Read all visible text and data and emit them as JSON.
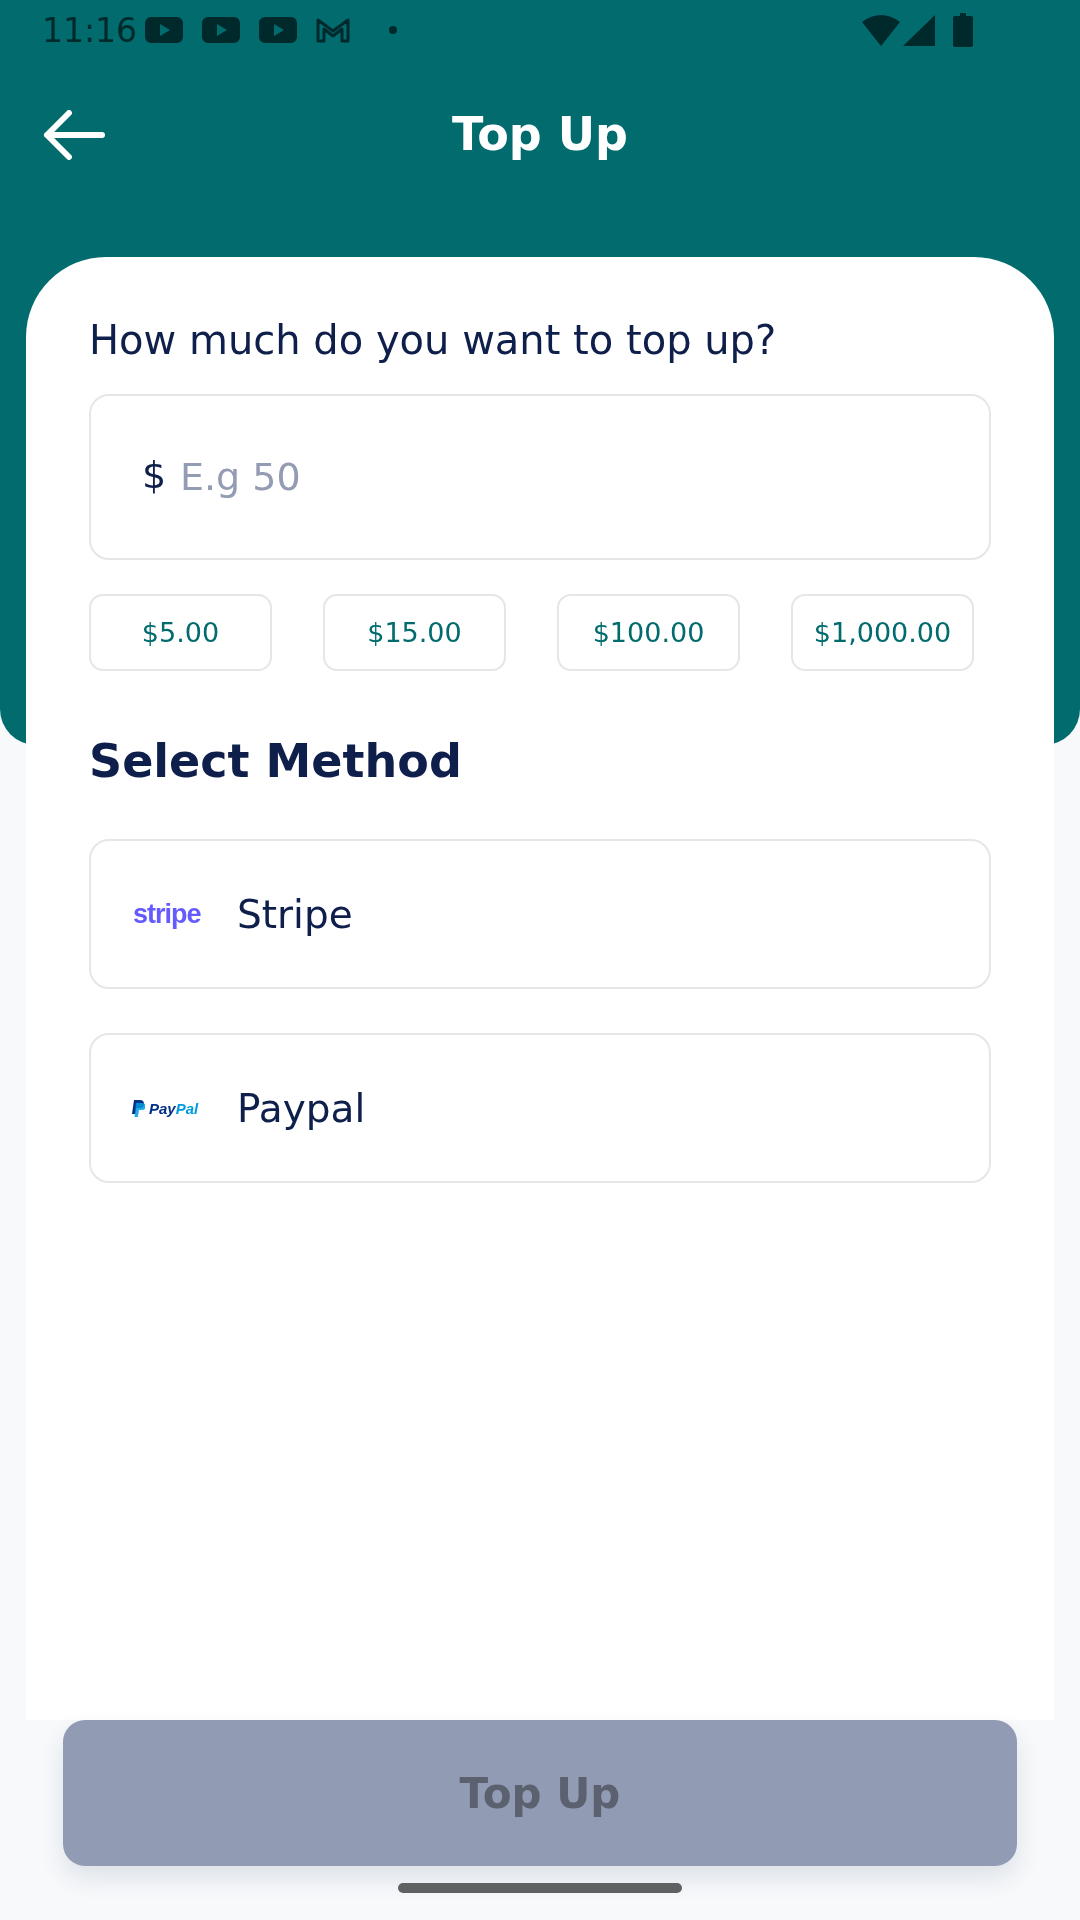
{
  "status_bar": {
    "time": "11:16"
  },
  "header": {
    "title": "Top Up"
  },
  "amount": {
    "label": "How much do you want to top up?",
    "currency": "$",
    "placeholder": "E.g 50"
  },
  "presets": [
    "$5.00",
    "$15.00",
    "$100.00",
    "$1,000.00"
  ],
  "method_section": {
    "title": "Select Method"
  },
  "methods": [
    {
      "kind": "stripe",
      "logo_parts": [
        "stripe"
      ],
      "name": "Stripe",
      "selected": false
    },
    {
      "kind": "paypal",
      "logo_parts": [
        "Pay",
        "Pal"
      ],
      "name": "Paypal",
      "selected": false
    }
  ],
  "submit": {
    "label": "Top Up",
    "disabled": true
  }
}
